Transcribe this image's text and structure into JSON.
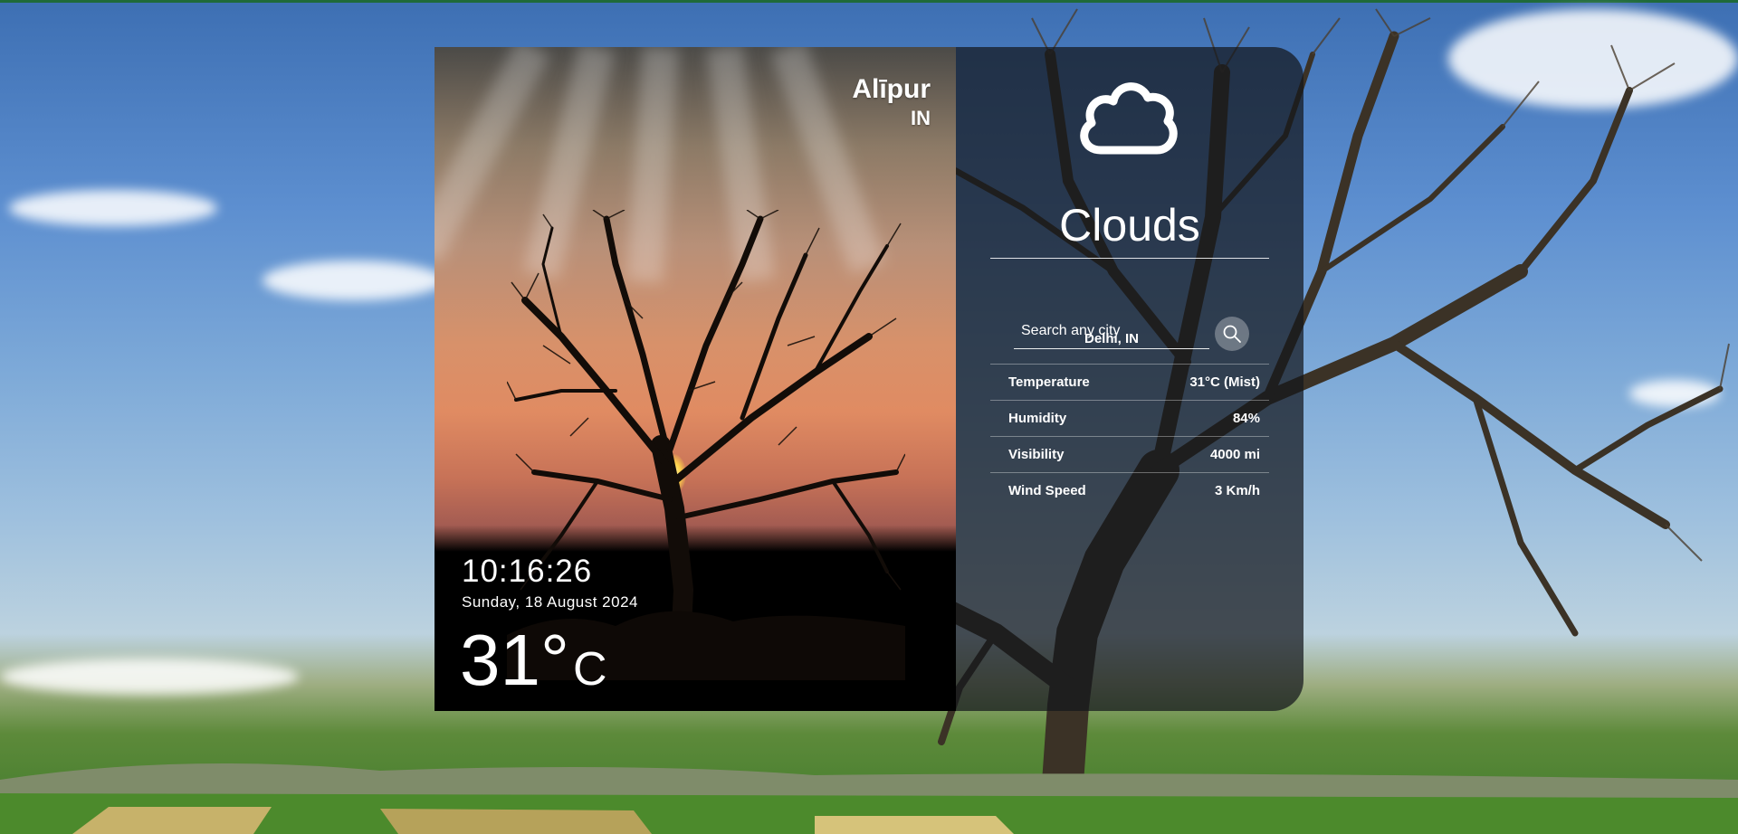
{
  "location": {
    "city": "Alīpur",
    "country": "IN"
  },
  "clock": {
    "time": "10:16:26",
    "date": "Sunday, 18 August 2024"
  },
  "current": {
    "temp_value": "31°",
    "temp_unit": "C"
  },
  "weather": {
    "icon": "cloud-icon",
    "condition": "Clouds"
  },
  "search": {
    "placeholder": "Search any city"
  },
  "details": {
    "location_label": "Delhi, IN",
    "rows": [
      {
        "label": "Temperature",
        "value": "31°C (Mist)"
      },
      {
        "label": "Humidity",
        "value": "84%"
      },
      {
        "label": "Visibility",
        "value": "4000 mi"
      },
      {
        "label": "Wind Speed",
        "value": "3 Km/h"
      }
    ]
  },
  "colors": {
    "panel_dark": "#14161c",
    "text": "#ffffff"
  }
}
